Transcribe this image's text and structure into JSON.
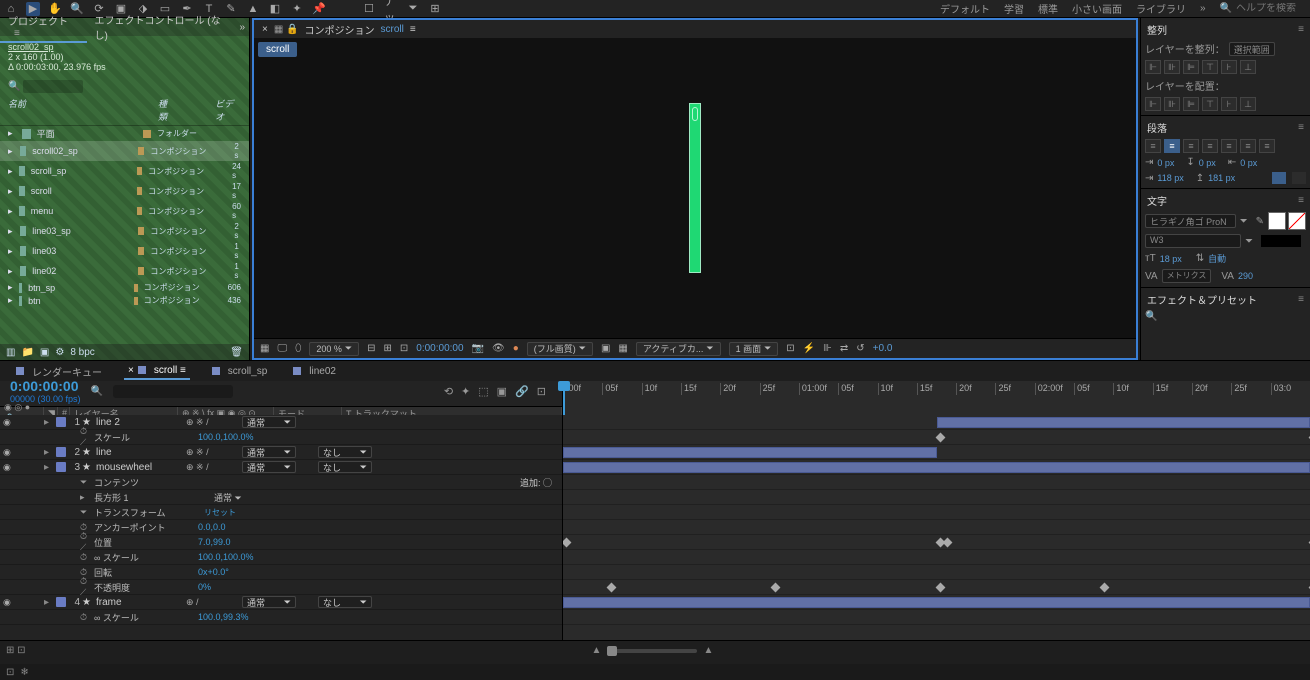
{
  "topbar": {
    "snap_label": "スナップ",
    "workspaces": [
      "デフォルト",
      "学習",
      "標準",
      "小さい画面",
      "ライブラリ"
    ],
    "help_placeholder": "ヘルプを検索"
  },
  "project": {
    "tab_project": "プロジェクト",
    "tab_effect": "エフェクトコントロール (なし)",
    "name": "scroll02_sp",
    "dims": "2 x 160 (1.00)",
    "dur": "Δ 0:00:03:00, 23.976 fps",
    "col_name": "名前",
    "col_type": "種類",
    "col_size": "ビデオ",
    "items": [
      {
        "name": "平面",
        "type": "フォルダー",
        "sel": false
      },
      {
        "name": "scroll02_sp",
        "type": "コンポジション",
        "dur": "2 s",
        "sel": true
      },
      {
        "name": "scroll_sp",
        "type": "コンポジション",
        "dur": "24 s",
        "sel": false
      },
      {
        "name": "scroll",
        "type": "コンポジション",
        "dur": "17 s",
        "sel": false
      },
      {
        "name": "menu",
        "type": "コンポジション",
        "dur": "60 s",
        "sel": false
      },
      {
        "name": "line03_sp",
        "type": "コンポジション",
        "dur": "2 s",
        "sel": false
      },
      {
        "name": "line03",
        "type": "コンポジション",
        "dur": "1 s",
        "sel": false
      },
      {
        "name": "line02",
        "type": "コンポジション",
        "dur": "1 s",
        "sel": false
      },
      {
        "name": "btn_sp",
        "type": "コンポジション",
        "dur": "606",
        "sel": false
      },
      {
        "name": "btn",
        "type": "コンポジション",
        "dur": "436",
        "sel": false
      }
    ],
    "footer_bpc": "8 bpc"
  },
  "viewer": {
    "title_prefix": "コンポジション",
    "title_comp": "scroll",
    "breadcrumb": "scroll",
    "footer": {
      "zoom": "200 %",
      "timecode": "0:00:00:00",
      "quality": "(フル画質)",
      "camera": "アクティブカ...",
      "view": "1 画面",
      "exposure": "+0.0"
    }
  },
  "align": {
    "title": "整列",
    "align_label": "レイヤーを整列：",
    "align_target": "選択範囲",
    "dist_label": "レイヤーを配置："
  },
  "paragraph": {
    "title": "段落",
    "indent_left": "0 px",
    "space_before": "0 px",
    "indent_right": "0 px",
    "first_line": "118 px",
    "space_after": "181 px"
  },
  "character": {
    "title": "文字",
    "font": "ヒラギノ角ゴ ProN",
    "weight": "W3",
    "size": "18 px",
    "leading": "自動",
    "tracking": "290",
    "kerning": "メトリクス"
  },
  "effects": {
    "title": "エフェクト＆プリセット"
  },
  "timeline": {
    "tabs": [
      {
        "label": "レンダーキュー",
        "active": false
      },
      {
        "label": "scroll",
        "active": true
      },
      {
        "label": "scroll_sp",
        "active": false
      },
      {
        "label": "line02",
        "active": false
      }
    ],
    "timecode": "0:00:00:00",
    "timecode_sub": "00000 (30.00 fps)",
    "ruler": [
      ":00f",
      "05f",
      "10f",
      "15f",
      "20f",
      "25f",
      "01:00f",
      "05f",
      "10f",
      "15f",
      "20f",
      "25f",
      "02:00f",
      "05f",
      "10f",
      "15f",
      "20f",
      "25f",
      "03:0"
    ],
    "head": {
      "num": "#",
      "name": "レイヤー名",
      "mode": "モード",
      "tm": "T トラックマット"
    },
    "layers": [
      {
        "n": 1,
        "name": "line 2",
        "mode": "通常",
        "tm": "",
        "sw": "⊕ ※ /"
      },
      {
        "n": 2,
        "name": "line",
        "mode": "通常",
        "tm": "なし",
        "sw": "⊕ ※ /"
      },
      {
        "n": 3,
        "name": "mousewheel",
        "mode": "通常",
        "tm": "なし",
        "sw": "⊕ ※ /"
      },
      {
        "n": 4,
        "name": "frame",
        "mode": "通常",
        "tm": "なし",
        "sw": "⊕  /"
      }
    ],
    "props": {
      "scale": "スケール",
      "scale_v": "100.0,100.0%",
      "contents": "コンテンツ",
      "add": "追加: ◯",
      "rect": "長方形 1",
      "rect_mode": "通常",
      "transform": "トランスフォーム",
      "reset": "リセット",
      "anchor": "アンカーポイント",
      "anchor_v": "0.0,0.0",
      "pos": "位置",
      "pos_v": "7.0,99.0",
      "scale2": "スケール",
      "scale2_v": "100.0,100.0%",
      "rot": "回転",
      "rot_v": "0x+0.0°",
      "opacity": "不透明度",
      "opacity_v": "0%",
      "scale4": "スケール",
      "scale4_v": "100.0,99.3%"
    }
  }
}
